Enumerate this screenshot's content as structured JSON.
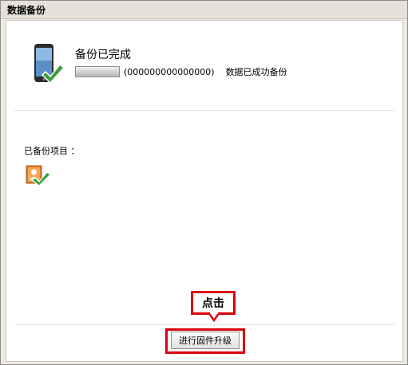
{
  "window": {
    "title": "数据备份"
  },
  "status": {
    "title": "备份已完成",
    "serial": "(000000000000000)",
    "message": "数据已成功备份"
  },
  "backed_up": {
    "label": "已备份项目 ："
  },
  "annotation": {
    "text": "点击"
  },
  "footer": {
    "upgrade_label": "进行固件升级"
  },
  "colors": {
    "highlight": "#d8000c",
    "check": "#3aa238"
  },
  "icons": {
    "device": "phone-check-icon",
    "contacts": "contacts-check-icon"
  }
}
